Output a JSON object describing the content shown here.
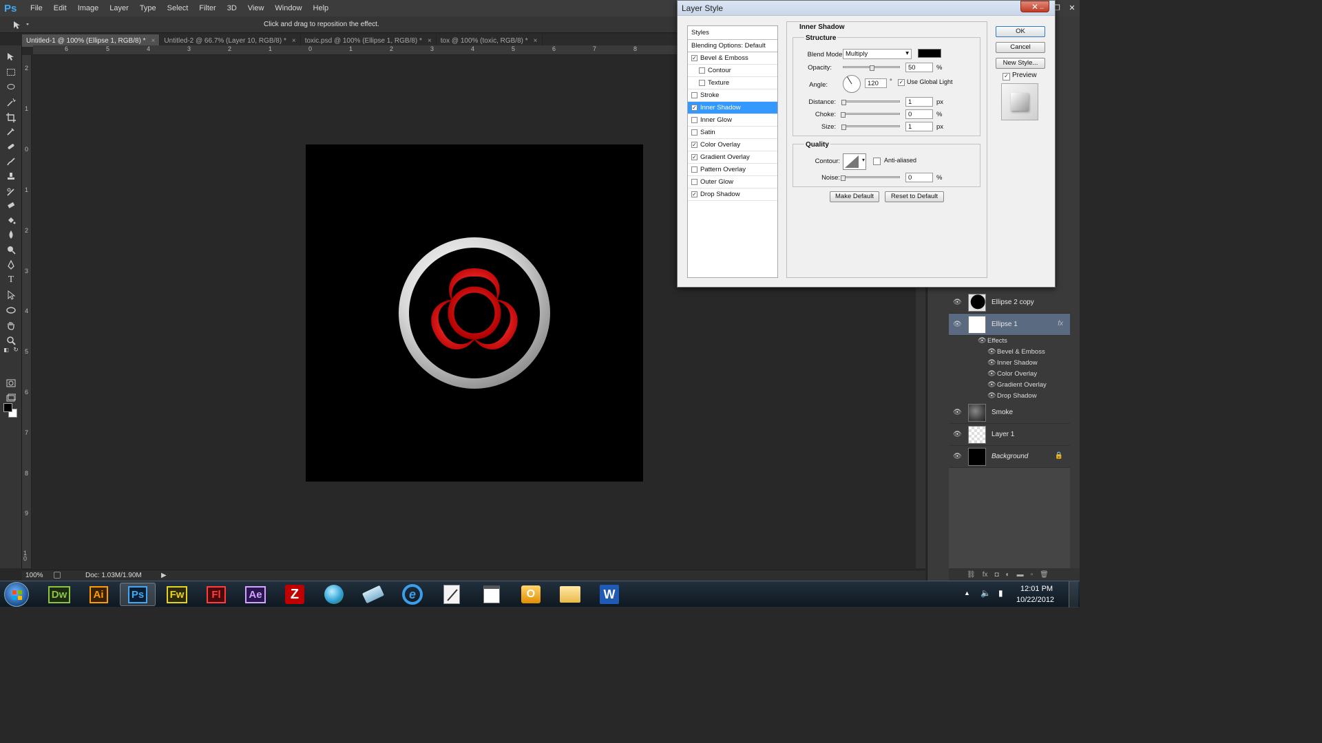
{
  "app": {
    "logo": "Ps"
  },
  "menu": [
    "File",
    "Edit",
    "Image",
    "Layer",
    "Type",
    "Select",
    "Filter",
    "3D",
    "View",
    "Window",
    "Help"
  ],
  "options_bar": {
    "hint": "Click and drag to reposition the effect."
  },
  "tabs": [
    {
      "label": "Untitled-1 @ 100% (Ellipse 1, RGB/8) *",
      "active": true
    },
    {
      "label": "Untitled-2 @ 66.7% (Layer 10, RGB/8) *",
      "active": false
    },
    {
      "label": "toxic.psd @ 100% (Ellipse 1, RGB/8) *",
      "active": false
    },
    {
      "label": "tox @ 100% (toxic, RGB/8) *",
      "active": false
    }
  ],
  "tab_close": "×",
  "ruler_top": [
    "6",
    "5",
    "4",
    "3",
    "2",
    "1",
    "0",
    "1",
    "2",
    "3",
    "4",
    "5",
    "6",
    "7",
    "8"
  ],
  "ruler_left": [
    "2",
    "1",
    "0",
    "1",
    "2",
    "3",
    "4",
    "5",
    "6",
    "7",
    "8",
    "9",
    "1 0"
  ],
  "status": {
    "zoom": "100%",
    "doc": "Doc: 1.03M/1.90M"
  },
  "dialog": {
    "title": "Layer Style",
    "close": "✕",
    "styles_header": "Styles",
    "blending_options": "Blending Options: Default",
    "style_items": [
      {
        "label": "Bevel & Emboss",
        "checked": true,
        "indent": false,
        "selected": false
      },
      {
        "label": "Contour",
        "checked": false,
        "indent": true,
        "selected": false
      },
      {
        "label": "Texture",
        "checked": false,
        "indent": true,
        "selected": false
      },
      {
        "label": "Stroke",
        "checked": false,
        "indent": false,
        "selected": false
      },
      {
        "label": "Inner Shadow",
        "checked": true,
        "indent": false,
        "selected": true
      },
      {
        "label": "Inner Glow",
        "checked": false,
        "indent": false,
        "selected": false
      },
      {
        "label": "Satin",
        "checked": false,
        "indent": false,
        "selected": false
      },
      {
        "label": "Color Overlay",
        "checked": true,
        "indent": false,
        "selected": false
      },
      {
        "label": "Gradient Overlay",
        "checked": true,
        "indent": false,
        "selected": false
      },
      {
        "label": "Pattern Overlay",
        "checked": false,
        "indent": false,
        "selected": false
      },
      {
        "label": "Outer Glow",
        "checked": false,
        "indent": false,
        "selected": false
      },
      {
        "label": "Drop Shadow",
        "checked": true,
        "indent": false,
        "selected": false
      }
    ],
    "section_title": "Inner Shadow",
    "structure": {
      "title": "Structure",
      "blend_mode_label": "Blend Mode:",
      "blend_mode": "Multiply",
      "shadow_color": "#000000",
      "opacity_label": "Opacity:",
      "opacity": "50",
      "opacity_level": 0.5,
      "angle_label": "Angle:",
      "angle": "120",
      "angle_unit": "°",
      "use_global_light": "Use Global Light",
      "distance_label": "Distance:",
      "distance": "1",
      "distance_level": 0.01,
      "choke_label": "Choke:",
      "choke": "0",
      "choke_level": 0,
      "size_label": "Size:",
      "size": "1",
      "size_level": 0.01,
      "px": "px",
      "pct": "%"
    },
    "quality": {
      "title": "Quality",
      "contour_label": "Contour:",
      "anti_aliased": "Anti-aliased",
      "noise_label": "Noise:",
      "noise": "0",
      "noise_level": 0
    },
    "make_default": "Make Default",
    "reset_default": "Reset to Default",
    "ok": "OK",
    "cancel": "Cancel",
    "new_style": "New Style...",
    "preview": "Preview"
  },
  "layers": [
    {
      "name": "Ellipse 2 copy",
      "thumb": "ellipse-dark",
      "fx": false,
      "selected": false,
      "italic": false
    },
    {
      "name": "Ellipse 1",
      "thumb": "ellipse-white",
      "fx": true,
      "selected": true,
      "italic": false
    },
    {
      "name": "Smoke",
      "thumb": "smoke",
      "fx": false,
      "selected": false,
      "italic": false
    },
    {
      "name": "Layer 1",
      "thumb": "transparent",
      "fx": false,
      "selected": false,
      "italic": false
    },
    {
      "name": "Background",
      "thumb": "black",
      "fx": false,
      "selected": false,
      "italic": true,
      "locked": true
    }
  ],
  "layer_effects": {
    "header": "Effects",
    "items": [
      "Bevel & Emboss",
      "Inner Shadow",
      "Color Overlay",
      "Gradient Overlay",
      "Drop Shadow"
    ]
  },
  "fx_symbol": "fx",
  "taskbar": {
    "apps": [
      {
        "label": "Dw",
        "color": "#8cc63f",
        "bg": "#1e2a12"
      },
      {
        "label": "Ai",
        "color": "#ff9a00",
        "bg": "#3a2200"
      },
      {
        "label": "Ps",
        "color": "#3fa9f5",
        "bg": "#0b1d30"
      },
      {
        "label": "Fw",
        "color": "#e8d21d",
        "bg": "#2c2a08"
      },
      {
        "label": "Fl",
        "color": "#ff3d3d",
        "bg": "#4a0a0a"
      },
      {
        "label": "Ae",
        "color": "#d3a3ff",
        "bg": "#2a1650"
      }
    ],
    "time": "12:01 PM",
    "date": "10/22/2012"
  },
  "colors": {
    "accent": "#3399ff",
    "biohazard": "#e10000"
  }
}
